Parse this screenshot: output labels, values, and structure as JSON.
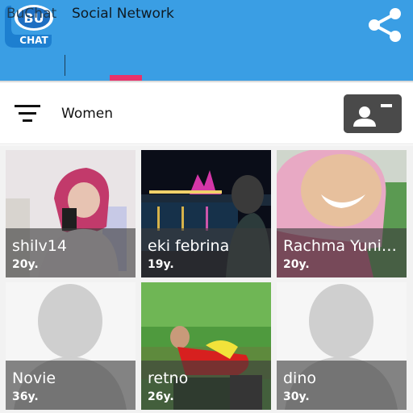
{
  "header": {
    "logo_top": "BU",
    "logo_bottom": "CHAT",
    "tabs": [
      {
        "label": "BuChat",
        "active": false
      },
      {
        "label": "Social Network",
        "active": true
      }
    ],
    "accent_color": "#3a9ee4",
    "indicator_color": "#e8336b",
    "share_icon": "share-icon"
  },
  "filter": {
    "label": "Women",
    "filter_icon": "filter-icon",
    "card_icon": "contact-card-icon"
  },
  "profiles": [
    {
      "name": "shilv14",
      "age": "20y.",
      "photo": "photo"
    },
    {
      "name": "eki febrina",
      "age": "19y.",
      "photo": "photo"
    },
    {
      "name": "Rachma Yuniarti",
      "age": "20y.",
      "photo": "photo"
    },
    {
      "name": "Novie",
      "age": "36y.",
      "photo": "placeholder-avatar"
    },
    {
      "name": "retno",
      "age": "26y.",
      "photo": "photo"
    },
    {
      "name": "dino",
      "age": "30y.",
      "photo": "placeholder-avatar"
    }
  ]
}
